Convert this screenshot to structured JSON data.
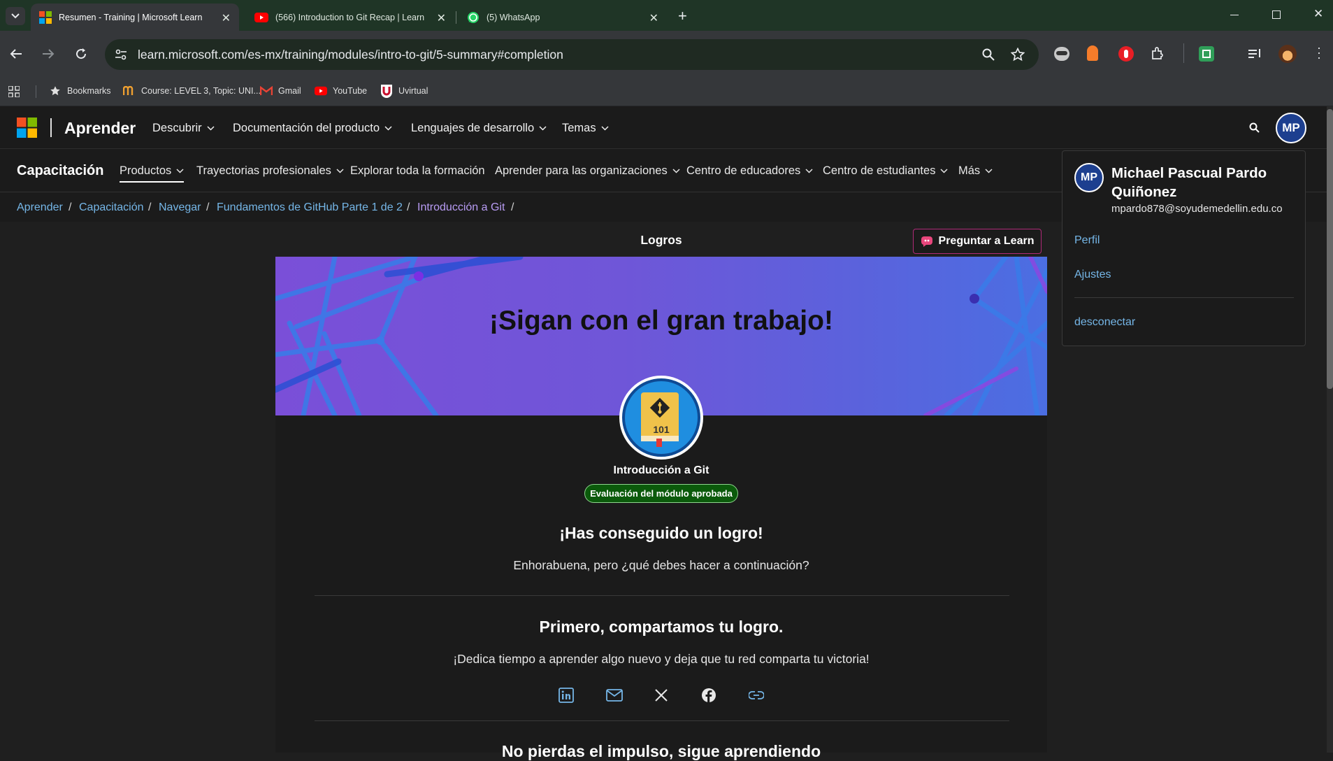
{
  "browser": {
    "tabs": [
      {
        "title": "Resumen - Training | Microsoft Learn",
        "icon": "microsoft-logo-icon",
        "active": true
      },
      {
        "title": "(566) Introduction to Git Recap | Learn wit",
        "icon": "youtube-icon",
        "active": false
      },
      {
        "title": "(5) WhatsApp",
        "icon": "whatsapp-icon",
        "active": false
      }
    ],
    "url": "learn.microsoft.com/es-mx/training/modules/intro-to-git/5-summary#completion",
    "bookmarks": [
      {
        "label": "Bookmarks",
        "icon": "star-icon"
      },
      {
        "label": "Course: LEVEL 3, Topic: UNI...",
        "icon": "course-icon"
      },
      {
        "label": "Gmail",
        "icon": "gmail-icon"
      },
      {
        "label": "YouTube",
        "icon": "youtube-icon"
      },
      {
        "label": "Uvirtual",
        "icon": "uvirtual-icon"
      }
    ]
  },
  "site": {
    "brand": "Aprender",
    "nav": [
      "Descubrir",
      "Documentación del producto",
      "Lenguajes de desarrollo",
      "Temas"
    ],
    "avatar_initials": "MP"
  },
  "training_nav": {
    "title": "Capacitación",
    "items": [
      "Productos",
      "Trayectorias profesionales",
      "Explorar toda la formación",
      "Aprender para las organizaciones",
      "Centro de educadores",
      "Centro de estudiantes",
      "Más"
    ]
  },
  "breadcrumbs": [
    "Aprender",
    "Capacitación",
    "Navegar",
    "Fundamentos de GitHub Parte 1 de 2",
    "Introducción a Git"
  ],
  "page": {
    "section_title": "Logros",
    "ask_button": "Preguntar a Learn",
    "banner_title": "¡Sigan con el gran trabajo!",
    "badge_text": "101",
    "module_name": "Introducción a Git",
    "status_badge": "Evaluación del módulo aprobada",
    "achievement_title": "¡Has conseguido un logro!",
    "achievement_text": "Enhorabuena, pero ¿qué debes hacer a continuación?",
    "share_title": "Primero, compartamos tu logro.",
    "share_text": "¡Dedica tiempo a aprender algo nuevo y deja que tu red comparta tu victoria!",
    "share_icons": [
      "linkedin-icon",
      "email-icon",
      "x-icon",
      "facebook-icon",
      "link-icon"
    ],
    "next_title": "No pierdas el impulso, sigue aprendiendo"
  },
  "profile": {
    "initials": "MP",
    "name_line1": "Michael Pascual Pardo",
    "name_line2": "Quiñonez",
    "email": "mpardo878@soyudemedellin.edu.co",
    "links": [
      "Perfil",
      "Ajustes"
    ],
    "signout": "desconectar"
  },
  "colors": {
    "link": "#75b6e7",
    "visited_link": "#b89cf4",
    "success": "#107c10",
    "avatar": "#1d3f8f",
    "banner_start": "#7a4fd8",
    "banner_end": "#4b6ee2"
  }
}
